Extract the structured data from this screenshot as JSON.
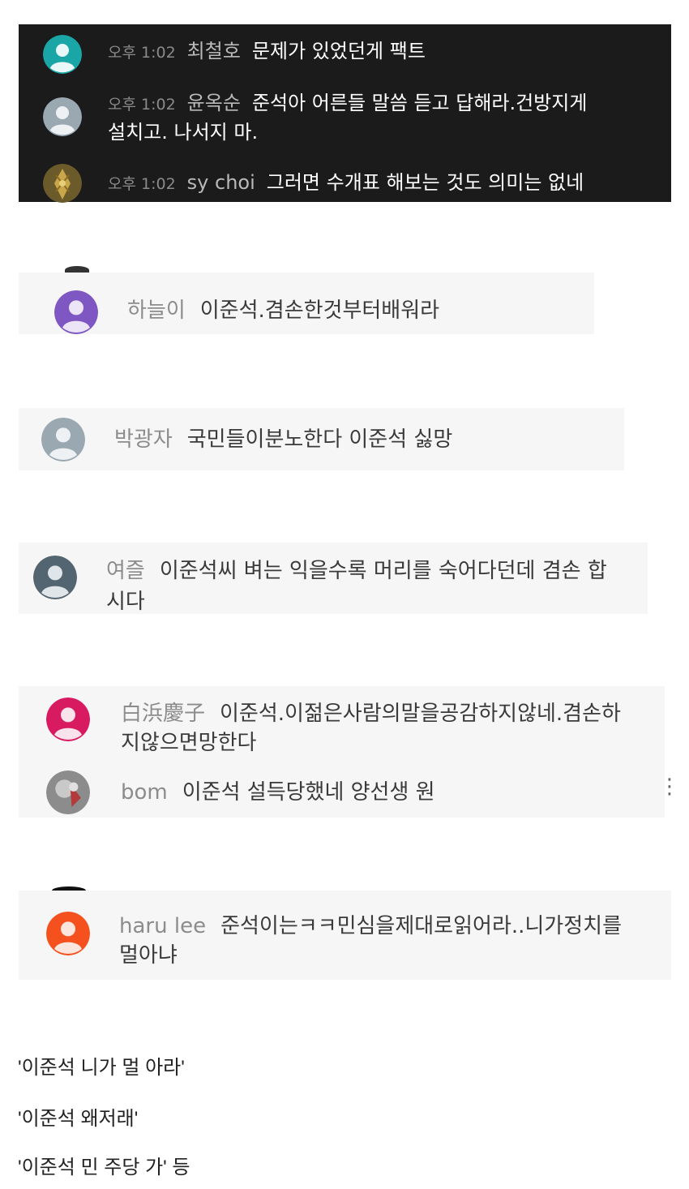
{
  "colors": {
    "dark_bg": "#1b1b1b",
    "light_bg": "#f6f6f6",
    "avatar_teal": "#1aa6a6",
    "avatar_gray": "#9aa8b1",
    "avatar_purple": "#7e57c2",
    "avatar_slate": "#536570",
    "avatar_pink": "#d81b60",
    "avatar_orange": "#f4511e"
  },
  "dark_chat": {
    "messages": [
      {
        "time": "오후 1:02",
        "author": "최철호",
        "text": "문제가 있었던게 팩트",
        "avatar": "default-avatar-icon"
      },
      {
        "time": "오후 1:02",
        "author": "윤옥순",
        "text": "준석아 어른들 말씀 듣고 답해라.건방지게 설치고. 나서지 마.",
        "avatar": "default-avatar-icon"
      },
      {
        "time": "오후 1:02",
        "author": "sy choi",
        "text": "그러면 수개표 해보는 것도 의미는 없네",
        "avatar": "photo-avatar-icon"
      }
    ]
  },
  "light_chats": [
    {
      "author": "하늘이",
      "text": "이준석.겸손한것부터배워라"
    },
    {
      "author": "박광자",
      "text": "국민들이분노한다 이준석 싫망"
    },
    {
      "author": "여즐",
      "text": "이준석씨 벼는 익을수록 머리를 숙어다던데 겸손 합시다"
    },
    {
      "author": "白浜慶子",
      "text": "이준석.이젊은사람의말을공감하지않네.겸손하지않으면망한다"
    },
    {
      "author": "bom",
      "text": "이준석 설득당했네 양선생 원"
    },
    {
      "author": "haru lee",
      "text": "준석이는ㅋㅋ민심을제대로읽어라..니가정치를멀아냐"
    }
  ],
  "captions": [
    "'이준석 니가 멀 아라'",
    "'이준석 왜저래'",
    "'이준석 민 주당 가' 등"
  ]
}
